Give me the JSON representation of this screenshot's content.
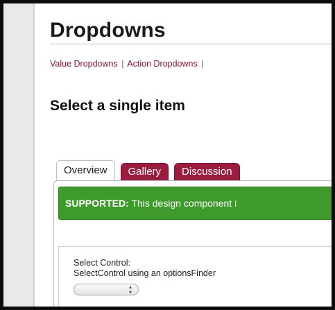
{
  "page": {
    "title": "Dropdowns",
    "subnav": {
      "links": [
        "Value Dropdowns",
        "Action Dropdowns"
      ],
      "separator": "|"
    },
    "section_title": "Select a single item"
  },
  "tabs": [
    {
      "label": "Overview",
      "active": true
    },
    {
      "label": "Gallery",
      "active": false
    },
    {
      "label": "Discussion",
      "active": false
    }
  ],
  "banner": {
    "strong": "SUPPORTED:",
    "text": " This design component i",
    "color": "#3f9a2c"
  },
  "control": {
    "line1": "Select Control:",
    "line2": "SelectControl using an optionsFinder",
    "select_icon": "updown-arrows-icon"
  },
  "colors": {
    "accent": "#9a1d3f",
    "link": "#8c1537",
    "supported_green": "#3f9a2c"
  }
}
